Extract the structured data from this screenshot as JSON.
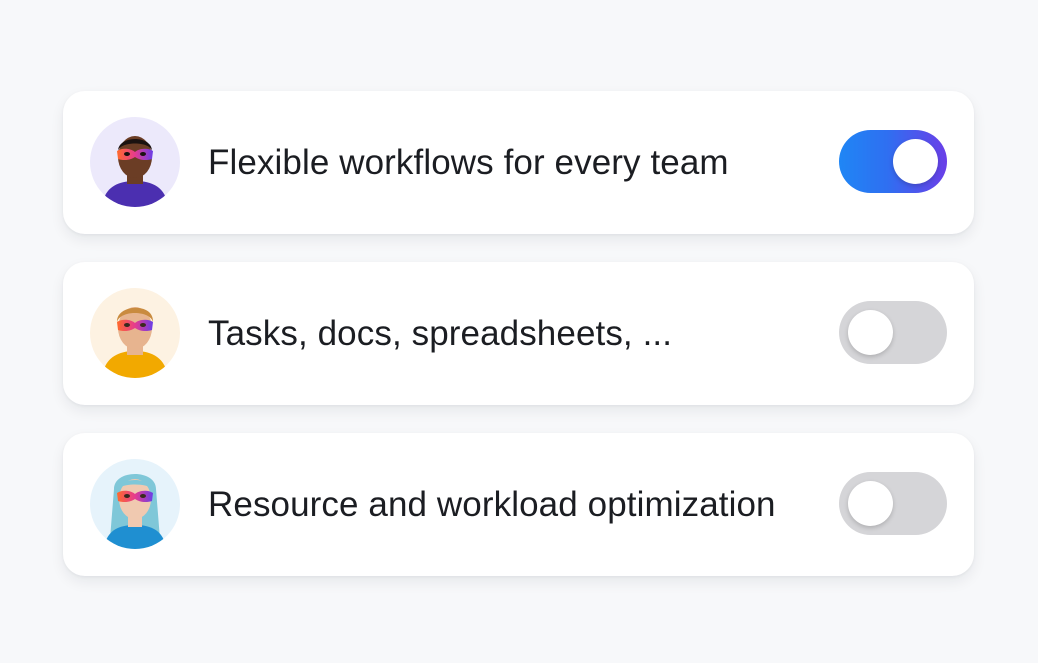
{
  "items": [
    {
      "label": "Flexible workflows for every team",
      "enabled": true,
      "avatar": {
        "bg": "#ece9fb",
        "skin": "#6b3d25",
        "hair": "#1b1210",
        "shirt": "#4b2fb0"
      }
    },
    {
      "label": "Tasks, docs, spreadsheets, ...",
      "enabled": false,
      "avatar": {
        "bg": "#fdf2e2",
        "skin": "#e7b48f",
        "hair": "#c98b3f",
        "shirt": "#f2a900"
      }
    },
    {
      "label": "Resource and workload optimization",
      "enabled": false,
      "avatar": {
        "bg": "#e6f3fb",
        "skin": "#f0c9b0",
        "hair": "#7fc7d8",
        "shirt": "#1f8fd1"
      }
    }
  ],
  "colors": {
    "toggle_on_start": "#1f86f5",
    "toggle_on_end": "#6a3ee8",
    "toggle_off": "#d5d5d8",
    "mask_start": "#ff6a2b",
    "mask_end": "#6a3ee8"
  }
}
